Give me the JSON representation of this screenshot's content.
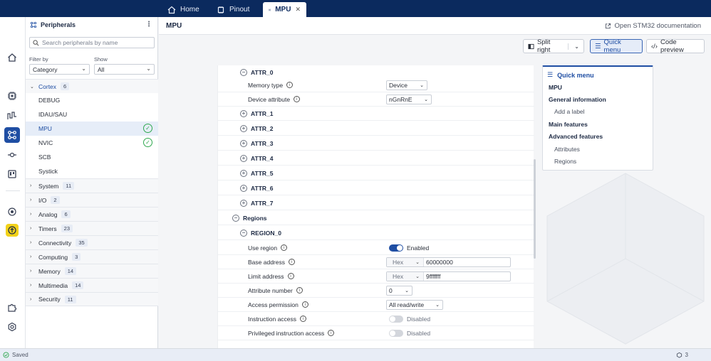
{
  "tabs": [
    {
      "label": "Home",
      "icon": "home-icon"
    },
    {
      "label": "Pinout",
      "icon": "pinout-icon"
    },
    {
      "label": "MPU",
      "icon": "peripheral-icon",
      "active": true
    }
  ],
  "sidebar": {
    "title": "Peripherals",
    "search_placeholder": "Search peripherals by name",
    "filter_label": "Filter by",
    "filter_value": "Category",
    "show_label": "Show",
    "show_value": "All",
    "categories": [
      {
        "name": "Cortex",
        "count": "6",
        "open": true,
        "items": [
          {
            "name": "DEBUG",
            "checked": false
          },
          {
            "name": "IDAU/SAU",
            "checked": false
          },
          {
            "name": "MPU",
            "checked": true,
            "selected": true
          },
          {
            "name": "NVIC",
            "checked": true
          },
          {
            "name": "SCB",
            "checked": false
          },
          {
            "name": "Systick",
            "checked": false
          }
        ]
      },
      {
        "name": "System",
        "count": "11"
      },
      {
        "name": "I/O",
        "count": "2"
      },
      {
        "name": "Analog",
        "count": "6"
      },
      {
        "name": "Timers",
        "count": "23"
      },
      {
        "name": "Connectivity",
        "count": "35"
      },
      {
        "name": "Computing",
        "count": "3"
      },
      {
        "name": "Memory",
        "count": "14"
      },
      {
        "name": "Multimedia",
        "count": "14"
      },
      {
        "name": "Security",
        "count": "11"
      }
    ]
  },
  "main": {
    "title": "MPU",
    "doc_link": "Open STM32 documentation",
    "split_right": "Split right",
    "quick_menu_btn": "Quick menu",
    "code_preview": "Code preview"
  },
  "config": {
    "attr0": "ATTR_0",
    "memory_type_label": "Memory type",
    "memory_type_value": "Device",
    "device_attr_label": "Device attribute",
    "device_attr_value": "nGnRnE",
    "attrs": [
      "ATTR_1",
      "ATTR_2",
      "ATTR_3",
      "ATTR_4",
      "ATTR_5",
      "ATTR_6",
      "ATTR_7"
    ],
    "regions": "Regions",
    "region0": "REGION_0",
    "use_region_label": "Use region",
    "use_region_value": "Enabled",
    "base_address_label": "Base address",
    "base_address_fmt": "Hex",
    "base_address_value": "60000000",
    "limit_address_label": "Limit address",
    "limit_address_fmt": "Hex",
    "limit_address_value": "9fffffff",
    "attr_number_label": "Attribute number",
    "attr_number_value": "0",
    "access_perm_label": "Access permission",
    "access_perm_value": "All read/write",
    "instr_access_label": "Instruction access",
    "instr_access_value": "Disabled",
    "priv_instr_label": "Privileged instruction access",
    "priv_instr_value": "Disabled"
  },
  "quick_menu": {
    "title": "Quick menu",
    "items": [
      {
        "label": "MPU",
        "level": 0
      },
      {
        "label": "General information",
        "level": 0
      },
      {
        "label": "Add a label",
        "level": 1
      },
      {
        "label": "Main features",
        "level": 0
      },
      {
        "label": "Advanced features",
        "level": 0
      },
      {
        "label": "Attributes",
        "level": 1
      },
      {
        "label": "Regions",
        "level": 1
      }
    ]
  },
  "status": {
    "saved": "Saved",
    "notifications": "3"
  }
}
